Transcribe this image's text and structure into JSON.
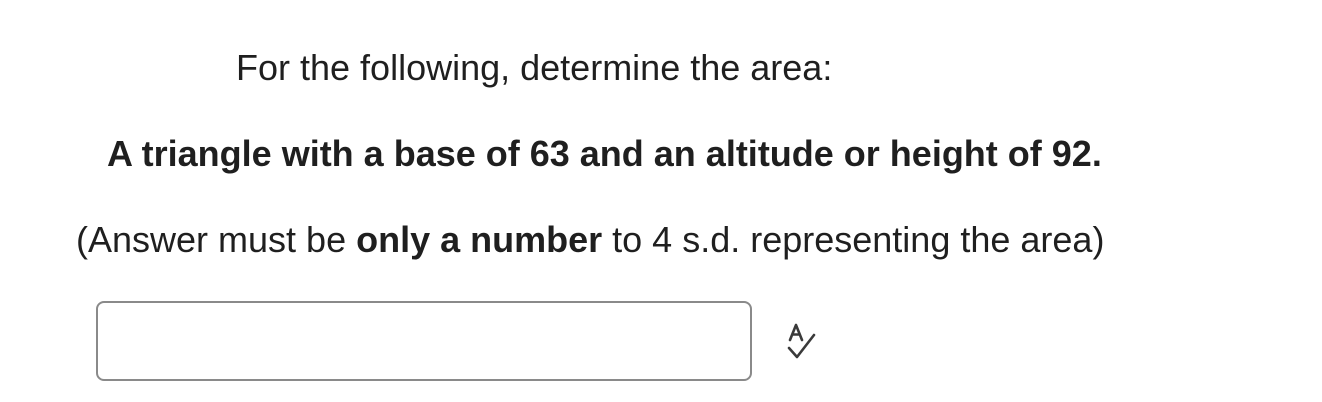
{
  "question": {
    "prompt": "For the following, determine the area:",
    "problem": "A triangle with a base of 63 and an altitude or height of 92.",
    "instruction": {
      "before": "(Answer must be ",
      "emphasis": "only a number",
      "after": " to 4 s.d. representing the area)"
    }
  },
  "answer": {
    "value": "",
    "placeholder": ""
  },
  "icons": {
    "spellcheck": "spellcheck-icon"
  },
  "colors": {
    "text": "#1f1f1f",
    "input_border": "#8a8a8a",
    "icon": "#3a3a3a"
  }
}
